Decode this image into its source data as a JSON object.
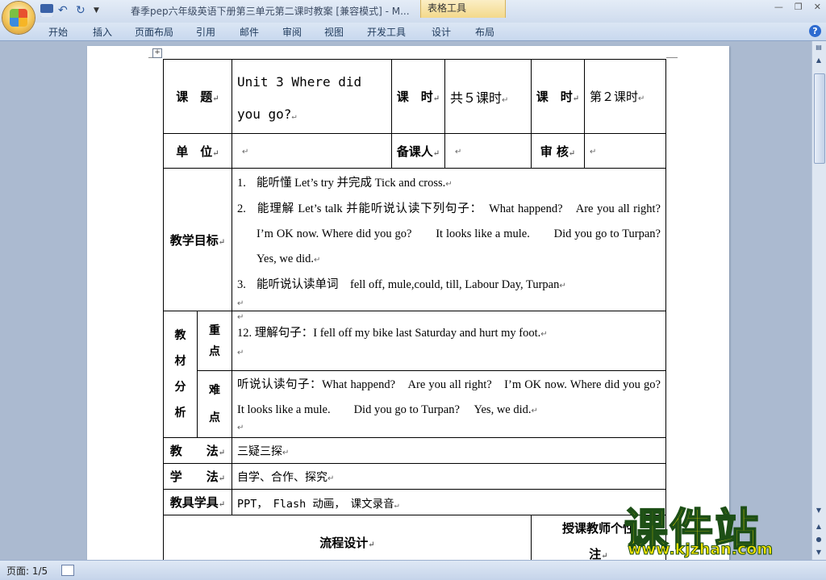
{
  "window": {
    "title": "春季pep六年级英语下册第三单元第二课时教案 [兼容模式] - M...",
    "context_tab": "表格工具"
  },
  "ribbon": {
    "tabs": [
      "开始",
      "插入",
      "页面布局",
      "引用",
      "邮件",
      "审阅",
      "视图",
      "开发工具",
      "设计",
      "布局"
    ]
  },
  "status": {
    "page": "页面: 1/5"
  },
  "lesson": {
    "title_label": "课　题",
    "title_value": "Unit 3 Where did you go?",
    "period_label_1": "课　时",
    "period_value_1": "共５课时",
    "period_label_2": "课　时",
    "period_value_2": "第２课时",
    "unit_label": "单　位",
    "preparer_label": "备课人",
    "reviewer_label": "审 核",
    "objectives_label": "教学目标",
    "objectives": [
      {
        "num": "1.",
        "text": "能听懂 Let’s try 并完成 Tick and cross."
      },
      {
        "num": "2.",
        "text": "能理解 Let’s talk 并能听说认读下列句子：　What happend?　Are you all right?　I’m OK now. Where did you go?　　It looks like a mule.　　Did you go to Turpan?　 Yes, we did."
      },
      {
        "num": "3.",
        "text": "能听说认读单词　fell off, mule,could, till, Labour Day, Turpan"
      }
    ],
    "analysis_label": "教材分析",
    "analysis_chars": [
      "教",
      "材",
      "分",
      "析"
    ],
    "key_label_chars": [
      "重",
      "点"
    ],
    "key_point": "12. 理解句子：I fell off my bike last Saturday and hurt my foot.",
    "difficult_label_chars": [
      "难",
      "点"
    ],
    "difficult_point": "听说认读句子：What happend?　Are you all right?　I’m OK now. Where did you go?　　It looks like a mule.　　Did you go to Turpan?　 Yes, we did.",
    "method_label": "教　　法",
    "method_value": "三疑三探",
    "study_label": "学　　法",
    "study_value": "自学、合作、探究",
    "tools_label": "教具学具",
    "tools_value": "PPT，　Flash 动画，　课文录音",
    "flow_label": "流程设计",
    "notes_label_1": "授课教师个性",
    "notes_label_2": "注"
  },
  "watermark": {
    "brand": "课件站",
    "url": "www.kjzhan.com"
  }
}
